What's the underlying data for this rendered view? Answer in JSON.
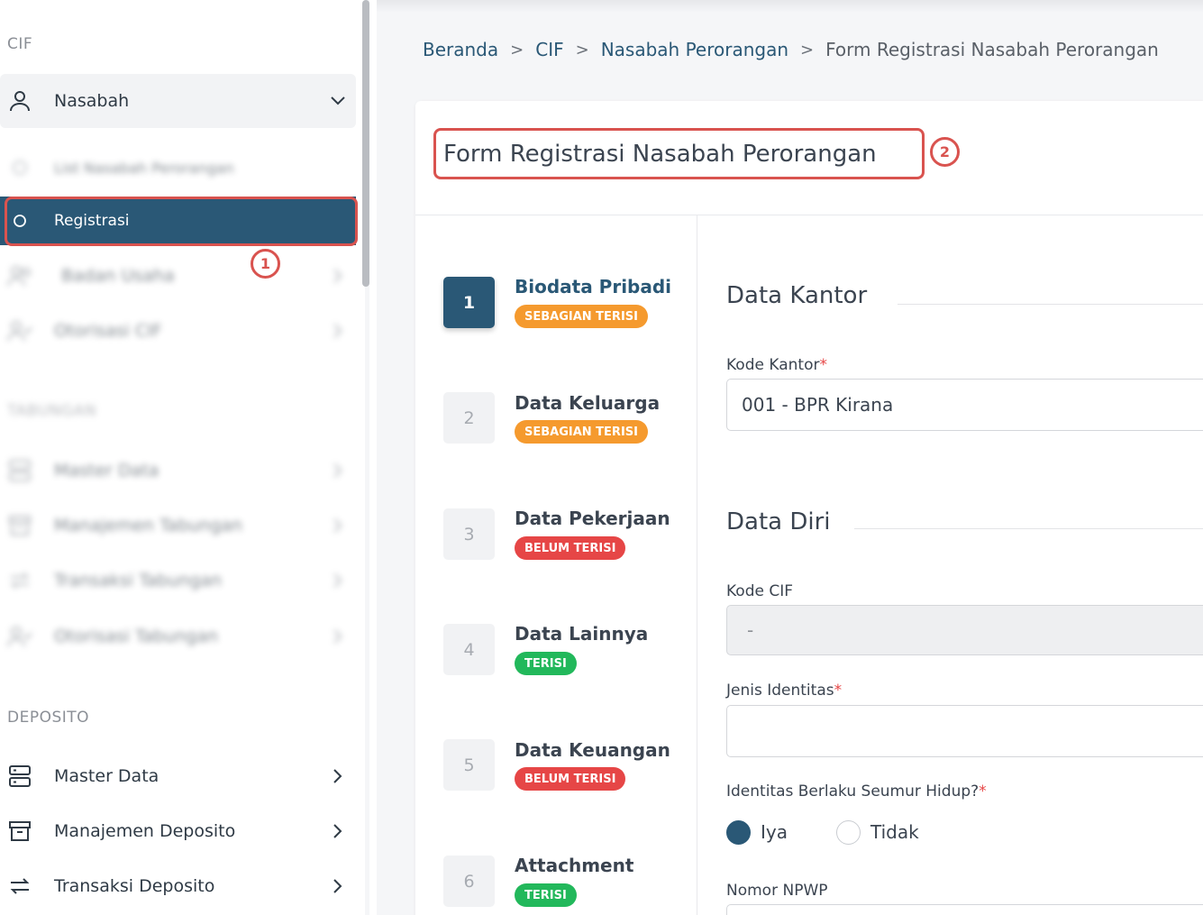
{
  "sidebar": {
    "cif_title": "CIF",
    "nasabah": "Nasabah",
    "list_nasabah": "List Nasabah Perorangan",
    "registrasi": "Registrasi",
    "badan_usaha": "Badan Usaha",
    "otorisasi_cif": "Otorisasi CIF",
    "tabungan_title": "TABUNGAN",
    "tab_master": "Master Data",
    "tab_manajemen": "Manajemen Tabungan",
    "tab_transaksi": "Transaksi Tabungan",
    "tab_otorisasi": "Otorisasi Tabungan",
    "deposito_title": "DEPOSITO",
    "dep_master": "Master Data",
    "dep_manajemen": "Manajemen Deposito",
    "dep_transaksi": "Transaksi Deposito"
  },
  "markers": {
    "m1": "1",
    "m2": "2"
  },
  "breadcrumb": {
    "beranda": "Beranda",
    "cif": "CIF",
    "nasabah": "Nasabah Perorangan",
    "current": "Form Registrasi Nasabah Perorangan",
    "sep": ">"
  },
  "card": {
    "title": "Form Registrasi Nasabah Perorangan"
  },
  "steps": [
    {
      "num": "1",
      "title": "Biodata Pribadi",
      "status": "SEBAGIAN TERISI"
    },
    {
      "num": "2",
      "title": "Data Keluarga",
      "status": "SEBAGIAN TERISI"
    },
    {
      "num": "3",
      "title": "Data Pekerjaan",
      "status": "BELUM TERISI"
    },
    {
      "num": "4",
      "title": "Data Lainnya",
      "status": "TERISI"
    },
    {
      "num": "5",
      "title": "Data Keuangan",
      "status": "BELUM TERISI"
    },
    {
      "num": "6",
      "title": "Attachment",
      "status": "TERISI"
    }
  ],
  "form": {
    "data_kantor": "Data Kantor",
    "kode_kantor_label": "Kode Kantor",
    "kode_kantor_value": "001 - BPR Kirana",
    "data_diri": "Data Diri",
    "kode_cif_label": "Kode CIF",
    "kode_cif_value": "-",
    "jenis_identitas_label": "Jenis Identitas",
    "jenis_identitas_value": "",
    "seumur_hidup_label": "Identitas Berlaku Seumur Hidup?",
    "opt_iya": "Iya",
    "opt_tidak": "Tidak",
    "npwp_label": "Nomor NPWP",
    "required_mark": "*"
  },
  "colors": {
    "primary": "#2a5876",
    "orange": "#f59a2e",
    "red": "#e64646",
    "green": "#22b85b",
    "highlight": "#d9534f"
  }
}
